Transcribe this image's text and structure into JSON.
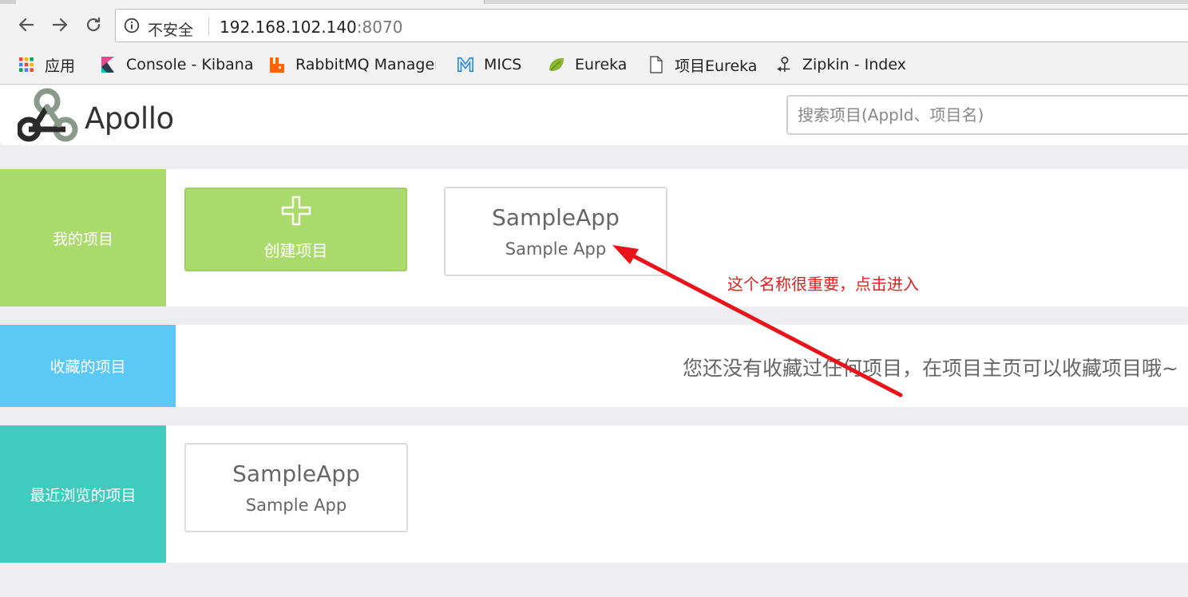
{
  "browser": {
    "insecure_label": "不安全",
    "url_host": "192.168.102.140",
    "url_port": ":8070",
    "bookmarks": [
      {
        "label": "应用",
        "icon": "apps-grid-icon"
      },
      {
        "label": "Console - Kibana",
        "icon": "kibana-icon"
      },
      {
        "label": "RabbitMQ Manager",
        "icon": "rabbitmq-icon"
      },
      {
        "label": "MICS",
        "icon": "mics-icon"
      },
      {
        "label": "Eureka",
        "icon": "eureka-leaf-icon"
      },
      {
        "label": "项目Eureka",
        "icon": "page-icon"
      },
      {
        "label": "Zipkin - Index",
        "icon": "zipkin-icon"
      }
    ]
  },
  "header": {
    "brand": "Apollo",
    "search_placeholder": "搜索项目(AppId、项目名)"
  },
  "sections": {
    "mine": {
      "label": "我的项目",
      "color": "#acdb6d",
      "create_label": "创建项目",
      "apps": [
        {
          "name": "SampleApp",
          "app_id": "Sample App"
        }
      ]
    },
    "favorites": {
      "label": "收藏的项目",
      "color": "#5bc8f5",
      "empty_message": "您还没有收藏过任何项目，在项目主页可以收藏项目哦~"
    },
    "recent": {
      "label": "最近浏览的项目",
      "color": "#40cbbf",
      "apps": [
        {
          "name": "SampleApp",
          "app_id": "Sample App"
        }
      ]
    }
  },
  "annotation": {
    "text": "这个名称很重要，点击进入",
    "color": "#e02020"
  }
}
